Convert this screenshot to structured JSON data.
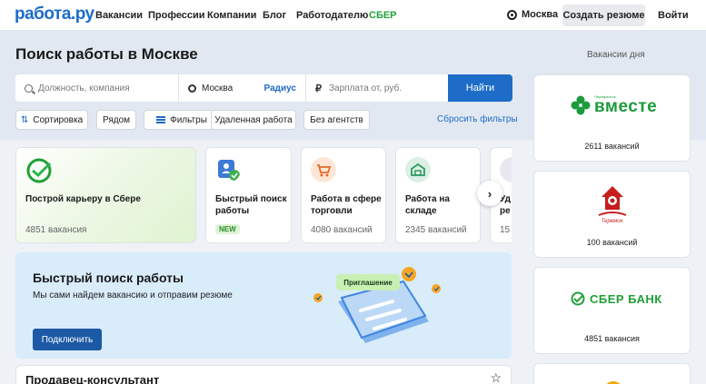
{
  "header": {
    "logo": "работа.ру",
    "nav": [
      {
        "label": "Вакансии",
        "name": "vacancies"
      },
      {
        "label": "Профессии",
        "name": "professions"
      },
      {
        "label": "Компании",
        "name": "companies"
      },
      {
        "label": "Блог",
        "name": "blog"
      },
      {
        "label": "Работодателю",
        "name": "employer"
      },
      {
        "label": "СБЕР",
        "name": "sber"
      }
    ],
    "city": "Москва",
    "create_resume": "Создать резюме",
    "login": "Войти"
  },
  "hero": {
    "title": "Поиск работы в Москве",
    "search": {
      "query_placeholder": "Должность, компания",
      "city_value": "Москва",
      "radius_label": "Радиус",
      "salary_placeholder": "Зарплата от, руб.",
      "find_button": "Найти"
    },
    "filters": {
      "sort": "Сортировка",
      "nearby": "Рядом",
      "filters": "Фильтры",
      "remote": "Удаленная работа",
      "no_agencies": "Без агентств",
      "reset": "Сбросить фильтры"
    }
  },
  "categories": [
    {
      "title": "Построй карьеру в Сбере",
      "count": "4851 вакансия"
    },
    {
      "title_line1": "Быстрый поиск",
      "title_line2": "работы",
      "badge": "NEW"
    },
    {
      "title_line1": "Работа в сфере",
      "title_line2": "торговли",
      "count": "4080 вакансий"
    },
    {
      "title_line1": "Работа на",
      "title_line2": "складе",
      "count": "2345 вакансий"
    },
    {
      "title_line1": "Уд",
      "title_line2": "ре",
      "count": "15"
    }
  ],
  "promo": {
    "title": "Быстрый поиск работы",
    "subtitle": "Мы сами найдем вакансию и отправим резюме",
    "button": "Подключить",
    "invitation": "Приглашение"
  },
  "vacancy": {
    "title": "Продавец-консультант"
  },
  "sidebar": {
    "title": "Вакансии дня",
    "employers": [
      {
        "logo_top": "Перекрёсток",
        "logo": "вместе",
        "count": "2611 вакансий"
      },
      {
        "logo": "Теремок",
        "count": "100 вакансий"
      },
      {
        "logo": "СБЕР БАНК",
        "count": "4851 вакансия"
      }
    ]
  },
  "colors": {
    "brand_blue": "#1d6cc8",
    "sber_green": "#21a038",
    "vmeste_green": "#1c9b3c",
    "teremok_red": "#c41e1e",
    "promo_bg": "#d8ecfa"
  }
}
